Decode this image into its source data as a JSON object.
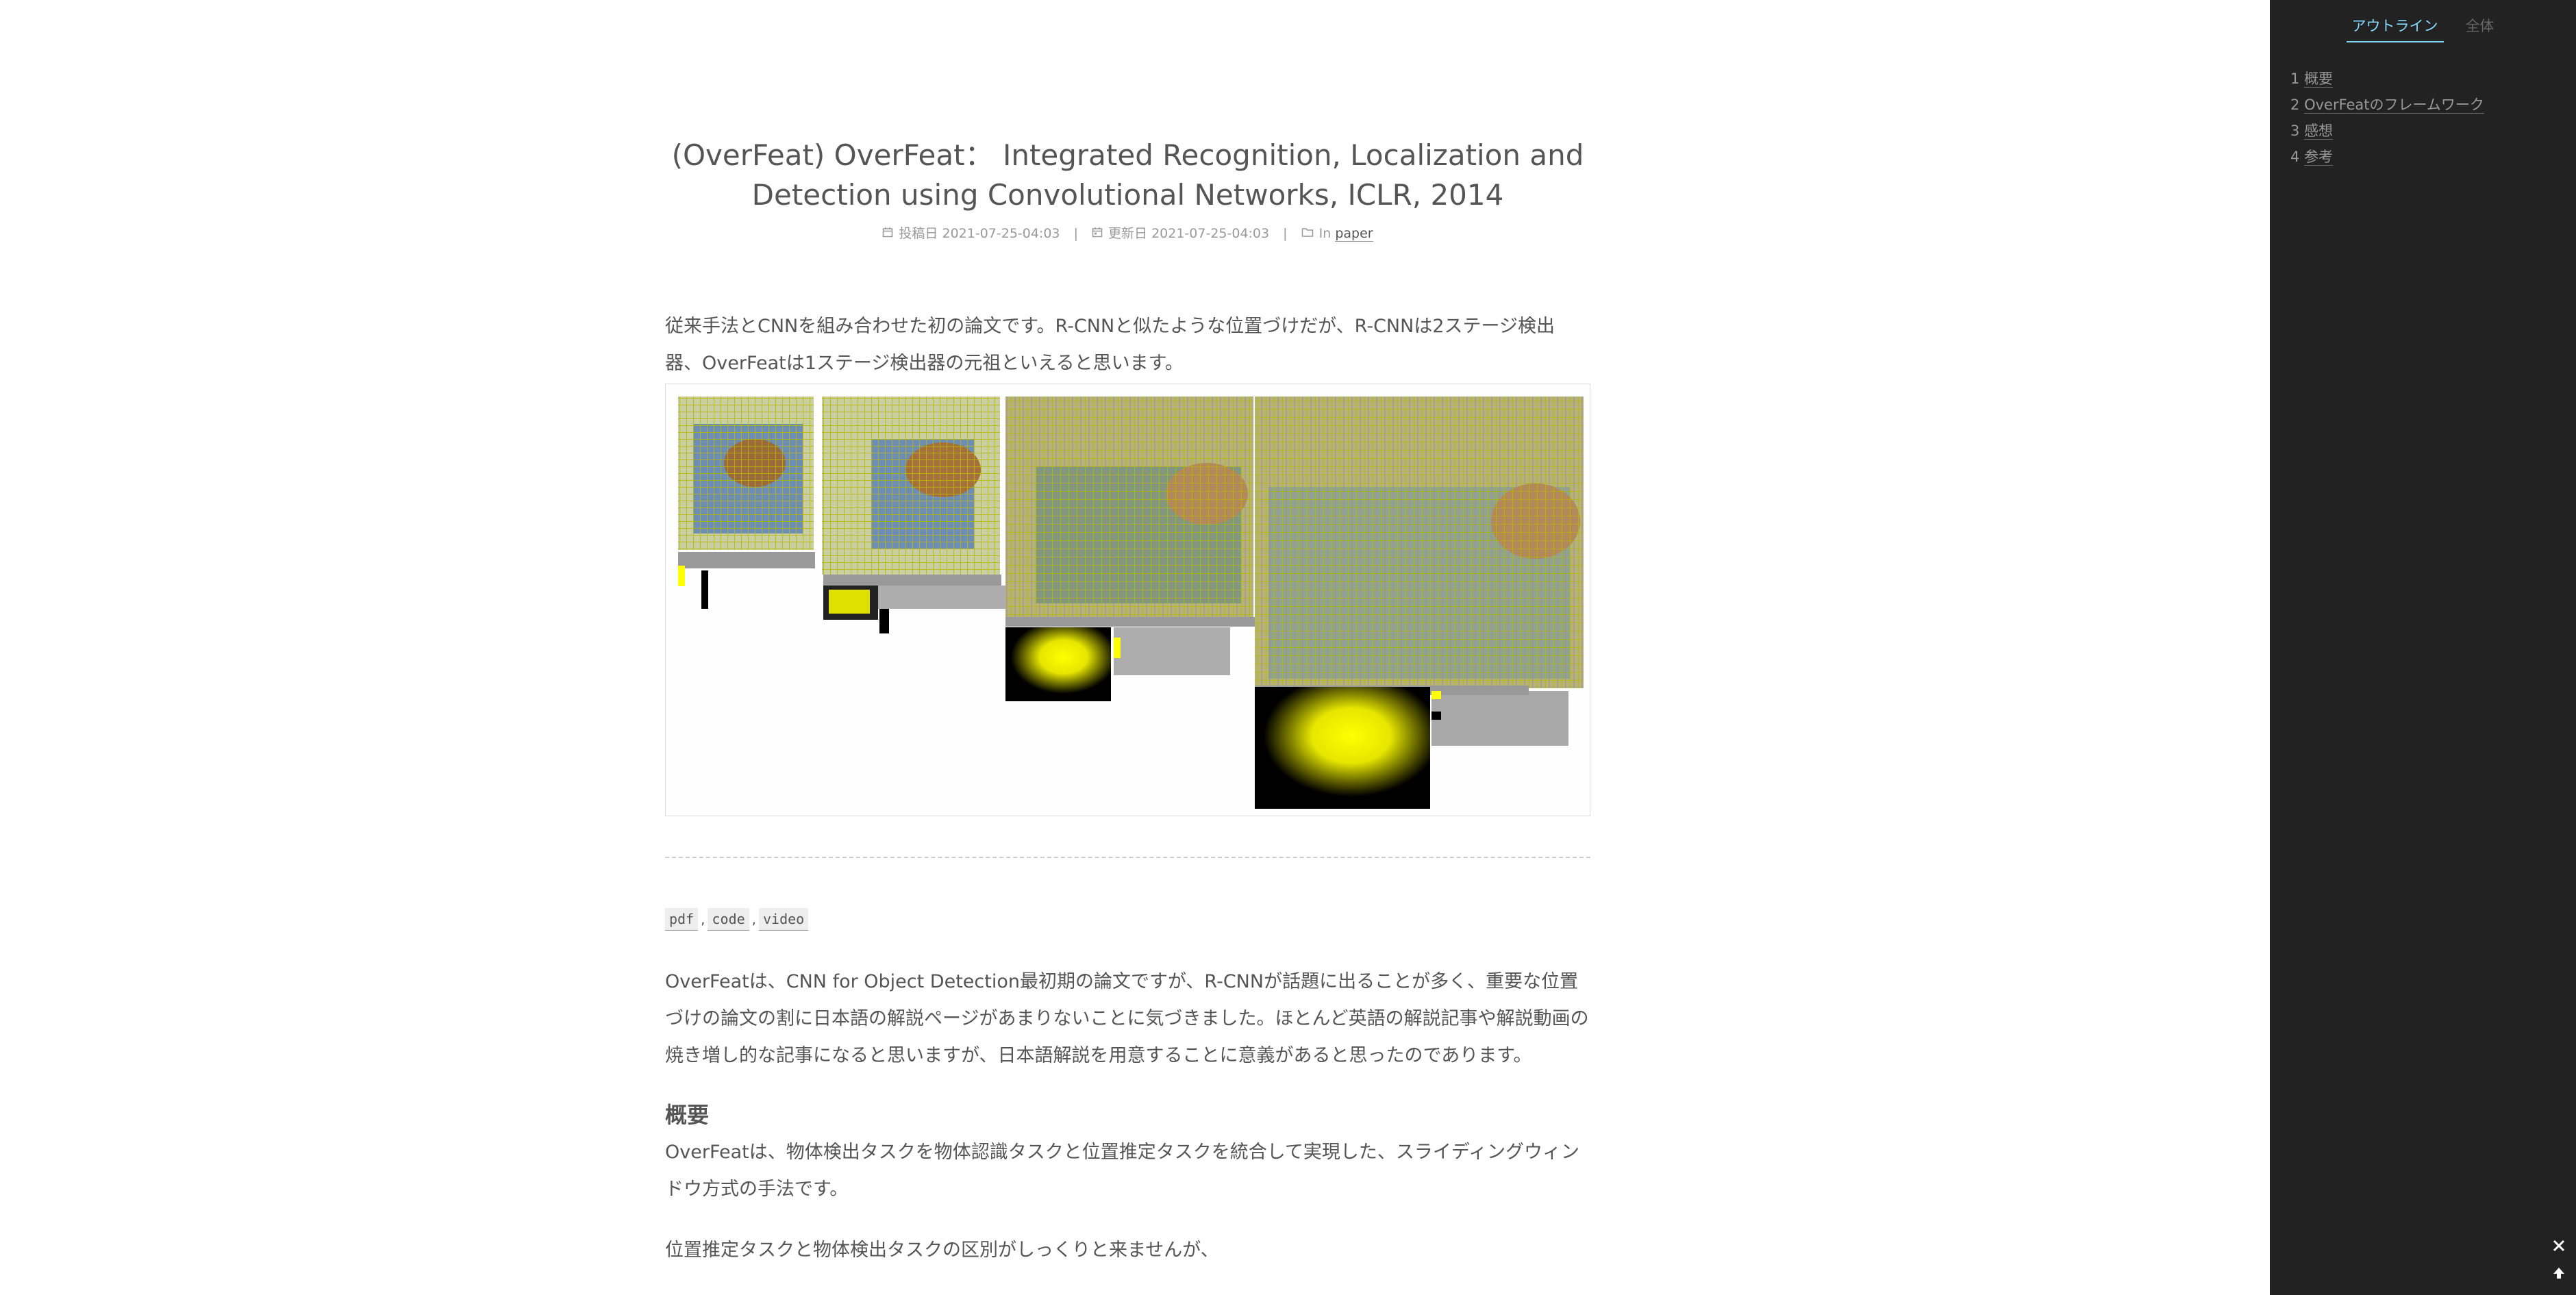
{
  "post": {
    "title": "(OverFeat) OverFeat： Integrated Recognition, Localization and Detection using Convolutional Networks, ICLR, 2014",
    "meta": {
      "posted_label": "投稿日",
      "posted_date": "2021-07-25-04:03",
      "updated_label": "更新日",
      "updated_date": "2021-07-25-04:03",
      "category_prefix": "In",
      "category": "paper"
    },
    "intro": "従来手法とCNNを組み合わせた初の論文です。R-CNNと似たような位置づけだが、R-CNNは2ステージ検出器、OverFeatは1ステージ検出器の元祖といえると思います。",
    "links": [
      "pdf",
      "code",
      "video"
    ],
    "body_paragraph": "OverFeatは、CNN for Object Detection最初期の論文ですが、R-CNNが話題に出ることが多く、重要な位置づけの論文の割に日本語の解説ページがあまりないことに気づきました。ほとんど英語の解説記事や解説動画の焼き増し的な記事になると思いますが、日本語解説を用意することに意義があると思ったのであります。",
    "section_heading": "概要",
    "overview": "OverFeatは、物体検出タスクを物体認識タスクと位置推定タスクを統合して実現した、スライディングウィンドウ方式の手法です。",
    "last_line": "位置推定タスクと物体検出タスクの区別がしっくりと来ませんが、"
  },
  "sidebar": {
    "tabs": [
      "アウトライン",
      "全体"
    ],
    "toc": [
      {
        "num": "1",
        "label": "概要"
      },
      {
        "num": "2",
        "label": "OverFeatのフレームワーク"
      },
      {
        "num": "3",
        "label": "感想"
      },
      {
        "num": "4",
        "label": "参考"
      }
    ],
    "close_icon": "close-icon",
    "back_to_top_icon": "arrow-up-icon"
  },
  "colors": {
    "sidebar_bg": "#222222",
    "accent": "#87daff",
    "text": "#555555",
    "detection_box": "#b8b800",
    "heatmap": "#ffff00"
  }
}
